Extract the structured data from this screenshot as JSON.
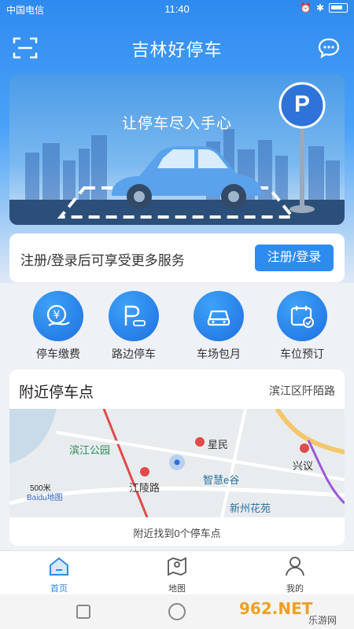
{
  "status_bar": {
    "carrier": "中国电信",
    "time": "11:40"
  },
  "header": {
    "title": "吉林好停车"
  },
  "banner": {
    "slogan": "让停车尽入手心",
    "parking_sign": "P"
  },
  "login": {
    "tip": "注册/登录后可享受更多服务",
    "button": "注册/登录"
  },
  "quick_actions": [
    {
      "label": "停车缴费",
      "icon": "yen-payment-icon"
    },
    {
      "label": "路边停车",
      "icon": "roadside-parking-icon"
    },
    {
      "label": "车场包月",
      "icon": "monthly-car-icon"
    },
    {
      "label": "车位预订",
      "icon": "calendar-booking-icon"
    }
  ],
  "nearby": {
    "title": "附近停车点",
    "location": "滨江区阡陌路",
    "map_labels": [
      "滨江公园",
      "星民",
      "江陵路",
      "智慧e谷",
      "兴议",
      "新州花苑",
      "500米",
      "Baidu地图"
    ],
    "result": "附近找到0个停车点"
  },
  "tabbar": [
    {
      "label": "首页",
      "icon": "home-icon",
      "active": true
    },
    {
      "label": "地图",
      "icon": "map-icon",
      "active": false
    },
    {
      "label": "我的",
      "icon": "user-icon",
      "active": false
    }
  ],
  "watermark": {
    "text": "962.NET",
    "sub": "乐游网"
  },
  "colors": {
    "primary": "#2e8bf0",
    "header_bg": "#2f8af0"
  }
}
